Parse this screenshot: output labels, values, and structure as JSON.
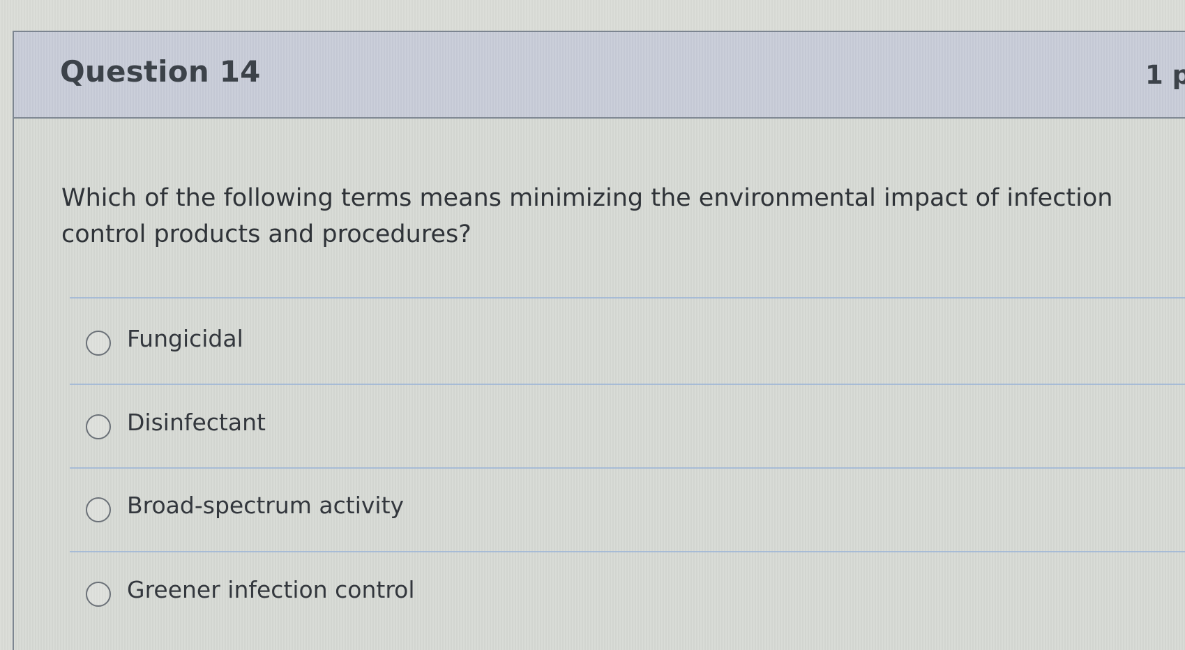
{
  "question": {
    "title": "Question 14",
    "points": "1 p",
    "text": "Which of the following terms means minimizing the environmental impact of infection control products and procedures?",
    "answers": [
      {
        "label": "Fungicidal"
      },
      {
        "label": "Disinfectant"
      },
      {
        "label": "Broad-spectrum activity"
      },
      {
        "label": "Greener infection control"
      }
    ]
  },
  "colors": {
    "header_background": "#c8ccd8",
    "border": "#7c8590",
    "divider": "#9fb6d6"
  }
}
